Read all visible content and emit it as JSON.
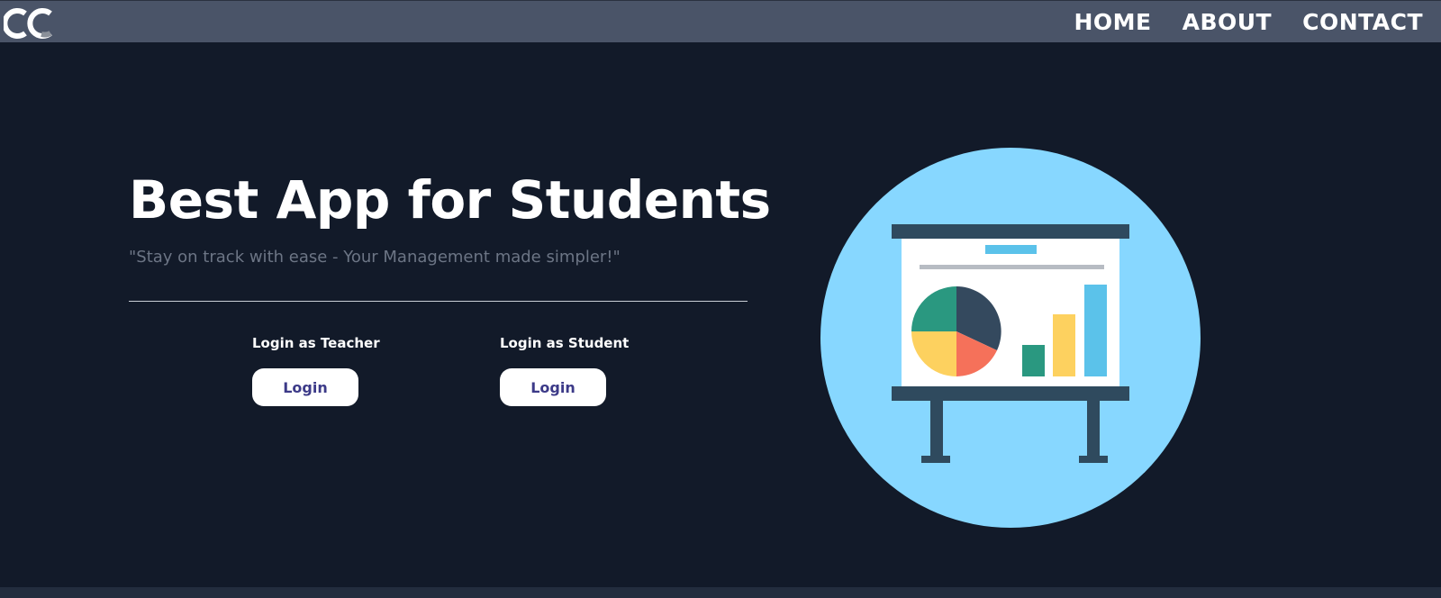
{
  "navbar": {
    "logo_text": "CC",
    "links": [
      "HOME",
      "ABOUT",
      "CONTACT"
    ]
  },
  "hero": {
    "title": "Best App for Students",
    "subtitle": "\"Stay on track with ease - Your Management made simpler!\""
  },
  "login": {
    "teacher": {
      "label": "Login as Teacher",
      "button": "Login"
    },
    "student": {
      "label": "Login as Student",
      "button": "Login"
    }
  },
  "colors": {
    "background": "#121a29",
    "navbar": "#4a5468",
    "circle": "#87d7ff",
    "button_text": "#3c3a88"
  },
  "illustration": {
    "icon": "presentation-board-icon"
  }
}
